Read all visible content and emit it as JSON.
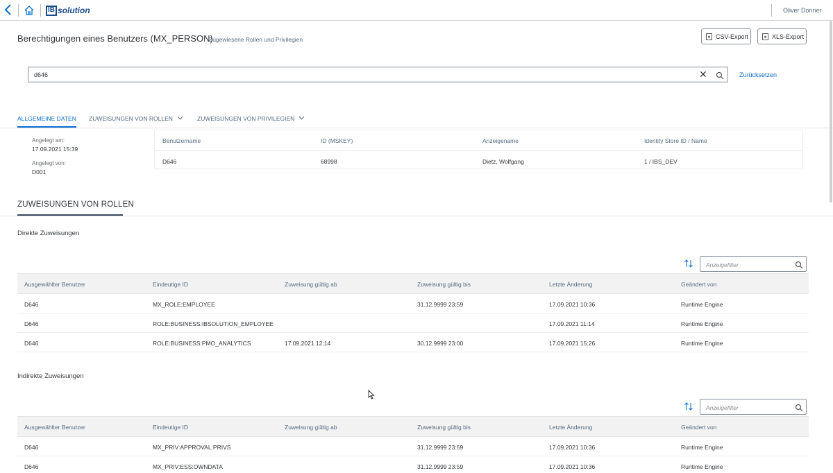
{
  "shell": {
    "logo_box": "IB",
    "logo_text": "solution",
    "user_name": "Oliver Donner"
  },
  "header": {
    "title": "Berechtigungen eines Benutzers (MX_PERSON)",
    "subtitle": "Zugewiesene Rollen und Privilegien",
    "csv_export": "CSV-Export",
    "xls_export": "XLS-Export"
  },
  "search": {
    "value": "d646",
    "reset": "Zurücksetzen"
  },
  "tabs": [
    {
      "label": "ALLGEMEINE DATEN",
      "active": true
    },
    {
      "label": "ZUWEISUNGEN VON ROLLEN",
      "active": false
    },
    {
      "label": "ZUWEISUNGEN VON PRIVILEGIEN",
      "active": false
    }
  ],
  "general": {
    "created_on_label": "Angelegt am:",
    "created_on_value": "17.09.2021 15:39",
    "created_by_label": "Angelegt von:",
    "created_by_value": "D001",
    "columns": [
      "Benutzername",
      "ID (MSKEY)",
      "Anzeigename",
      "Identity Store ID / Name"
    ],
    "values": [
      "D646",
      "68998",
      "Dietz, Wolfgang",
      "1 / IBS_DEV"
    ]
  },
  "roles_section": {
    "title": "ZUWEISUNGEN VON ROLLEN",
    "direct_title": "Direkte Zuweisungen",
    "indirect_title": "Indirekte Zuweisungen",
    "filter_placeholder": "Anzeigefilter",
    "columns": [
      "Ausgewählter Benutzer",
      "Eindeutige ID",
      "Zuweisung gültig ab",
      "Zuweisung gültig bis",
      "Letzte Änderung",
      "Geändert von"
    ],
    "direct_rows": [
      [
        "D646",
        "MX_ROLE:EMPLOYEE",
        "",
        "31.12.9999 23:59",
        "17.09.2021 10:36",
        "Runtime Engine"
      ],
      [
        "D646",
        "ROLE:BUSINESS:IBSOLUTION_EMPLOYEE",
        "",
        "",
        "17.09.2021 11:14",
        "Runtime Engine"
      ],
      [
        "D646",
        "ROLE:BUSINESS:PMO_ANALYTICS",
        "17.09.2021 12:14",
        "30.12.9999 23:00",
        "17.09.2021 15:26",
        "Runtime Engine"
      ]
    ],
    "indirect_rows": [
      [
        "D646",
        "MX_PRIV:APPROVAL:PRIVS",
        "",
        "31.12.9999 23:59",
        "17.09.2021 10:36",
        "Runtime Engine"
      ],
      [
        "D646",
        "MX_PRIV:ESS:OWNDATA",
        "",
        "31.12.9999 23:59",
        "17.09.2021 10:36",
        "Runtime Engine"
      ]
    ]
  },
  "colors": {
    "accent": "#0a6ed1",
    "text": "#32363a",
    "muted": "#556b82",
    "table_header_bg": "#f2f2f2"
  }
}
